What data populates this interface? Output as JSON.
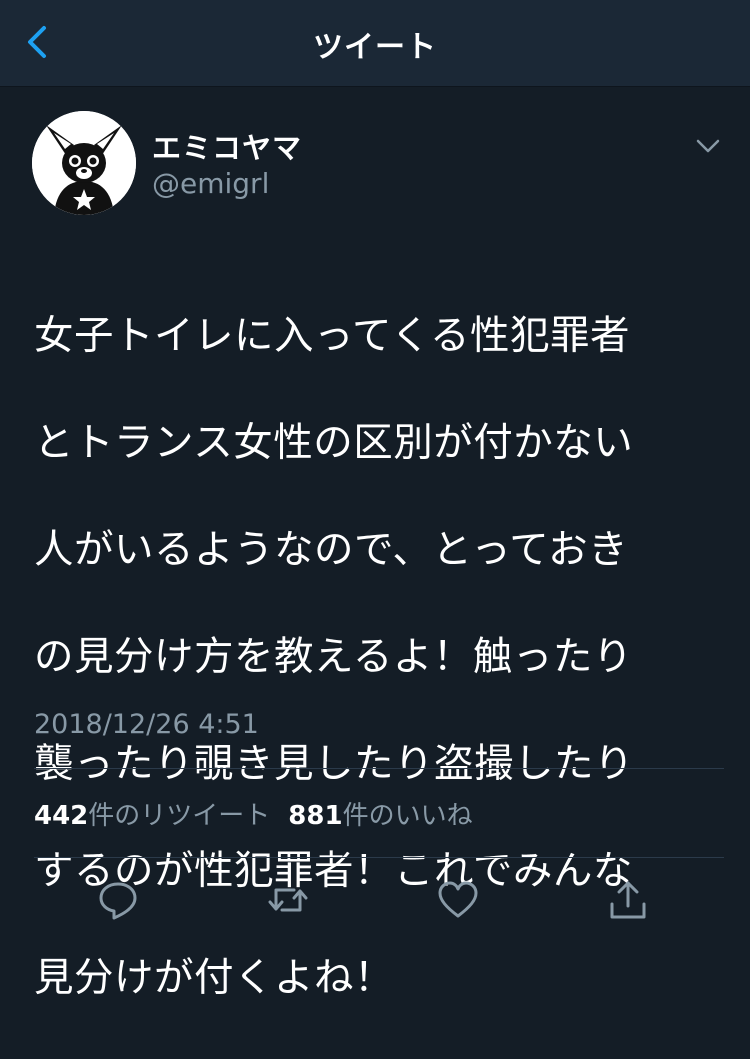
{
  "nav": {
    "title": "ツイート",
    "back_icon": "chevron-left-icon"
  },
  "tweet": {
    "display_name": "エミコヤマ",
    "handle": "@emigrl",
    "text_lines": [
      "女子トイレに入ってくる性犯罪者",
      "とトランス女性の区別が付かない",
      "人がいるようなので、とっておき",
      "の見分け方を教えるよ！触ったり",
      "襲ったり覗き見したり盗撮したり",
      "するのが性犯罪者！これでみんな",
      "見分けが付くよね！"
    ],
    "timestamp": "2018/12/26 4:51",
    "retweet_count": "442",
    "retweet_label": "件のリツイート",
    "like_count": "881",
    "like_label": "件のいいね"
  },
  "actions": [
    {
      "name": "reply",
      "icon": "reply-icon"
    },
    {
      "name": "retweet",
      "icon": "retweet-icon"
    },
    {
      "name": "like",
      "icon": "heart-icon"
    },
    {
      "name": "share",
      "icon": "share-icon"
    }
  ],
  "colors": {
    "background": "#141d26",
    "nav_background": "#1b2836",
    "accent": "#1da1f2",
    "secondary_text": "#8899a6",
    "divider": "#2b3a4a"
  }
}
